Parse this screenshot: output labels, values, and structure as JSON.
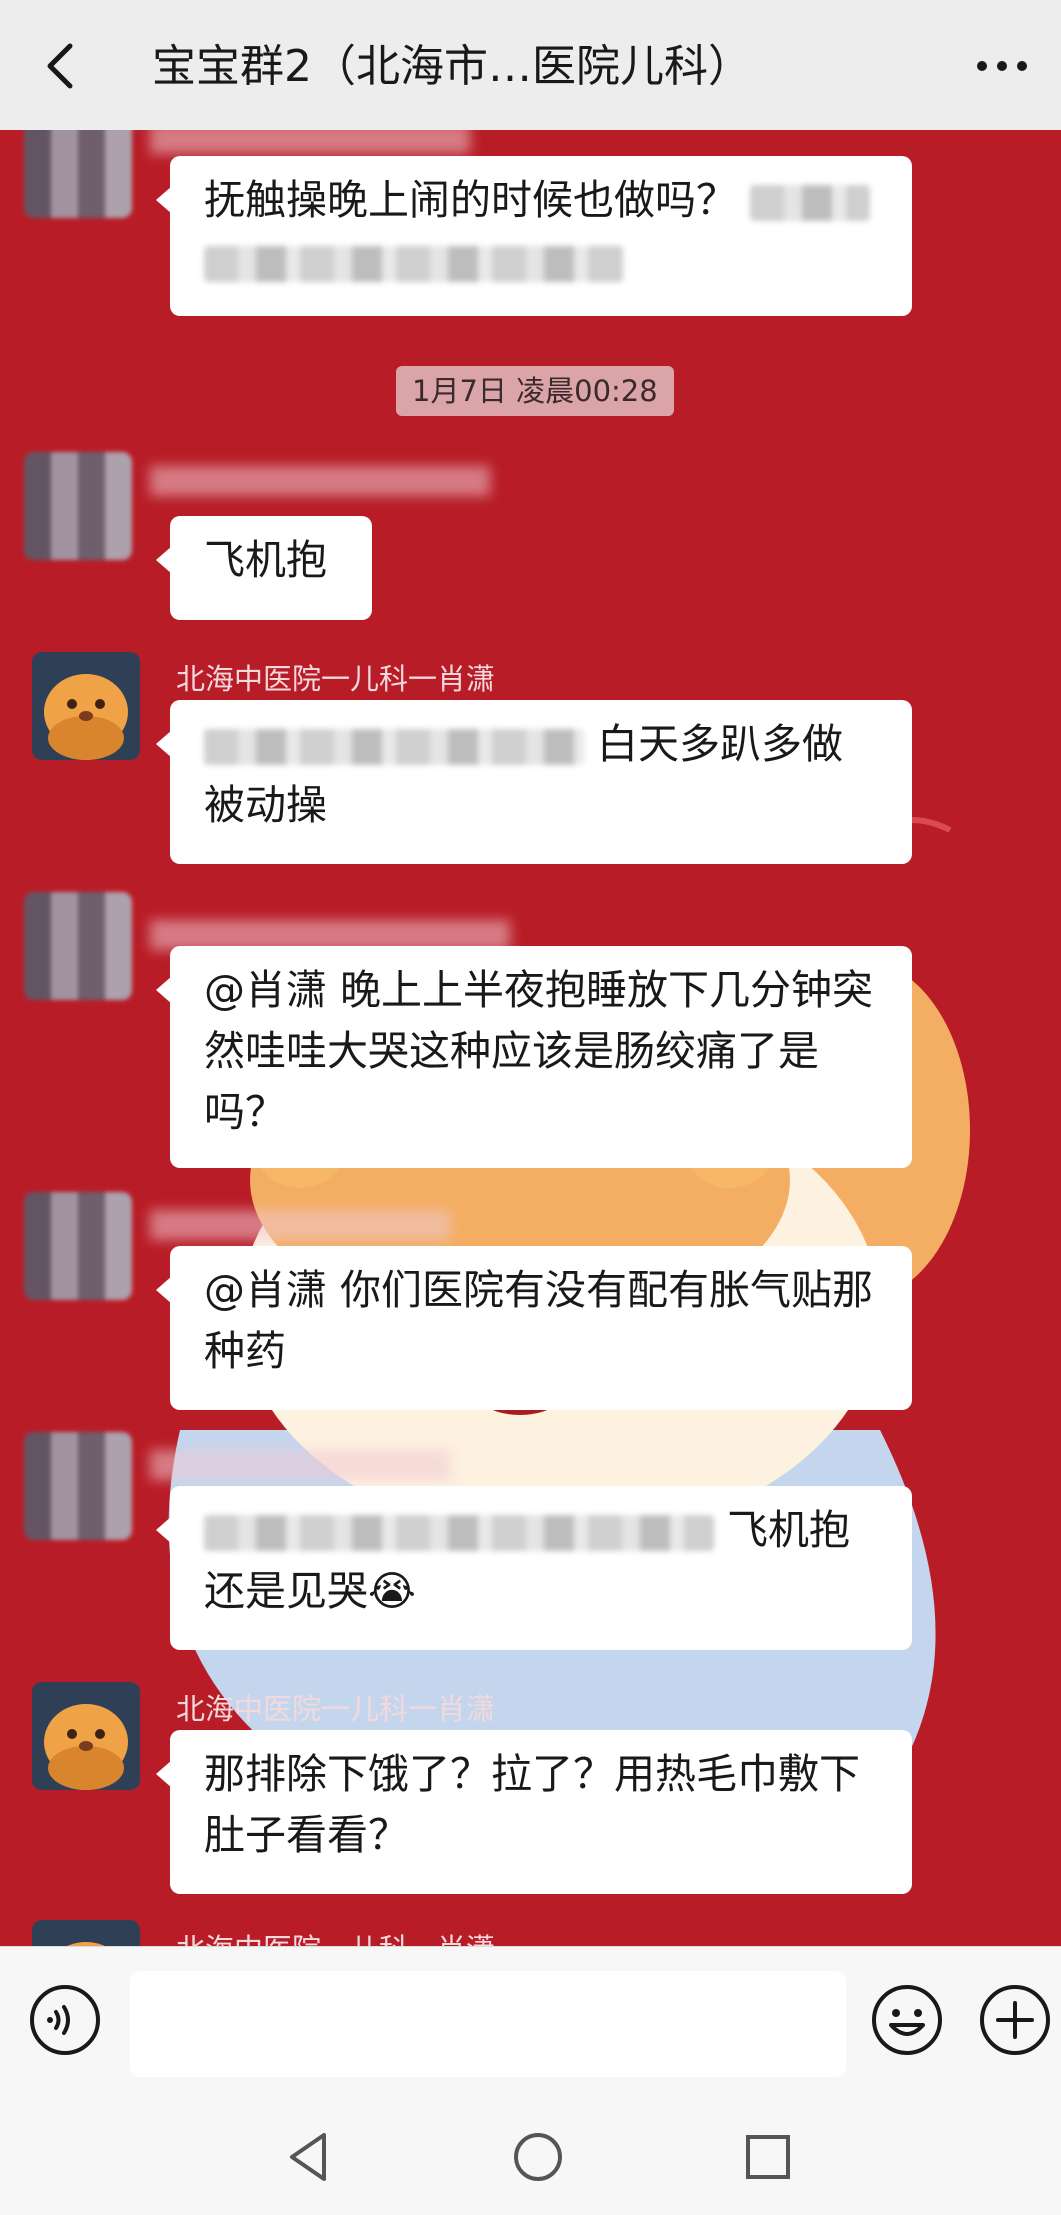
{
  "header": {
    "title": "宝宝群2（北海市…医院儿科）",
    "back_icon": "chevron-left-icon",
    "more_icon": "more-dots-icon"
  },
  "timestamp": "1月7日 凌晨00:28",
  "messages": [
    {
      "sender": "",
      "text": "抚触操晚上闹的时候也做吗？"
    },
    {
      "sender": "",
      "text": "飞机抱"
    },
    {
      "sender": "北海中医院一儿科一肖潇",
      "text_tail": "白天多趴多做被动操"
    },
    {
      "sender": "",
      "text": "@肖潇  晚上上半夜抱睡放下几分钟突然哇哇大哭这种应该是肠绞痛了是吗？"
    },
    {
      "sender": "",
      "text": "@肖潇  你们医院有没有配有胀气贴那种药"
    },
    {
      "sender": "",
      "text_tail": "飞机抱还是见哭",
      "emoji": "😭"
    },
    {
      "sender": "北海中医院一儿科一肖潇",
      "text": "那排除下饿了？拉了？用热毛巾敷下肚子看看？"
    },
    {
      "sender": "北海中医院一儿科一肖潇",
      "text": ""
    }
  ],
  "bottom_bar": {
    "voice_icon": "voice-icon",
    "emoji_icon": "emoji-icon",
    "plus_icon": "plus-icon",
    "input_value": ""
  },
  "navbar": {
    "back": "nav-back-icon",
    "home": "nav-home-icon",
    "recent": "nav-recent-icon"
  },
  "colors": {
    "chat_bg": "#b81d27",
    "bubble": "#ffffff",
    "header_bg": "#ededed",
    "timestamp_bg": "#dba4a9"
  }
}
